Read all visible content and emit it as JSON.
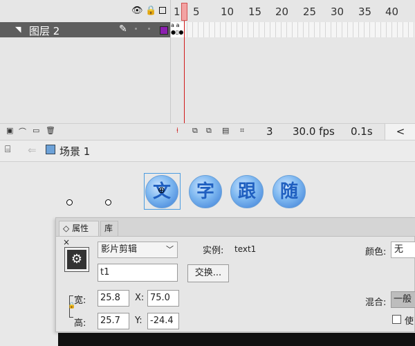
{
  "timeline": {
    "ruler": [
      "1",
      "5",
      "10",
      "15",
      "20",
      "25",
      "30",
      "35",
      "40"
    ],
    "layer": {
      "name": "图层 2",
      "color": "#8c1fb0"
    },
    "footer": {
      "current_frame": "3",
      "frame_rate": "30.0 fps",
      "elapsed": "0.1s"
    }
  },
  "edit_bar": {
    "scene": "场景 1"
  },
  "stage": {
    "buttons": [
      "文",
      "字",
      "跟",
      "随"
    ]
  },
  "properties": {
    "tabs": [
      "属性",
      "库"
    ],
    "tab_close": "×",
    "symbol_type": "影片剪辑",
    "instance_label": "实例:",
    "instance_value": "text1",
    "color_label": "颜色:",
    "color_value": "无",
    "instance_name": "t1",
    "swap_label": "交换...",
    "width_label": "宽:",
    "width": "25.8",
    "height_label": "高:",
    "height": "25.7",
    "x_label": "X:",
    "x": "75.0",
    "y_label": "Y:",
    "y": "-24.4",
    "blend_label": "混合:",
    "blend_value": "一般",
    "use_label": "使"
  }
}
